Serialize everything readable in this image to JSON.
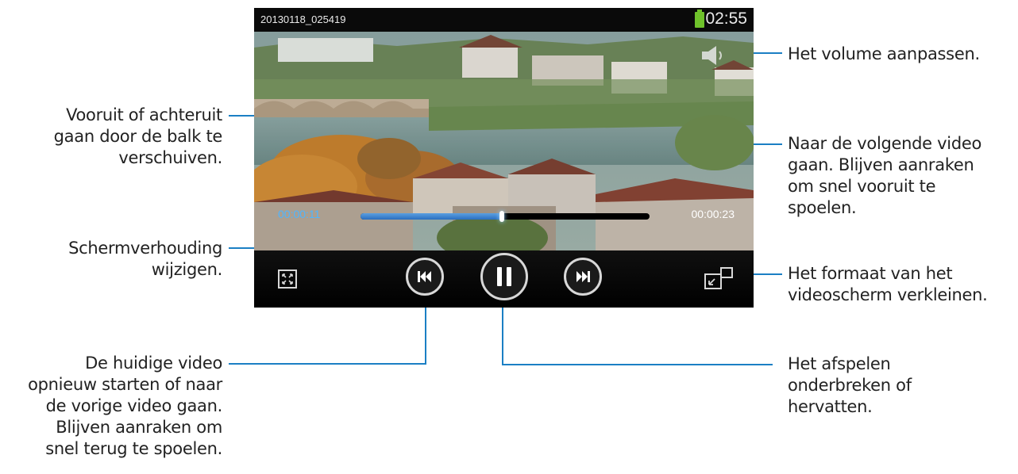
{
  "player": {
    "filename": "20130118_025419",
    "clock": "02:55",
    "elapsed": "00:00:11",
    "total": "00:00:23",
    "progress": 0.49,
    "accent_color": "#1b7fc4",
    "battery_color": "#6fc22b"
  },
  "icons": {
    "volume": "speaker-icon",
    "aspect": "aspect-ratio-icon",
    "prev": "skip-previous-icon",
    "pause": "pause-icon",
    "next": "skip-next-icon",
    "minimize": "picture-in-picture-icon"
  },
  "callouts": {
    "volume": "Het volume aanpassen.",
    "seek": "Vooruit of achteruit\ngaan door de balk te\nverschuiven.",
    "next": "Naar de volgende video\ngaan. Blijven aanraken\nom snel vooruit te\nspoelen.",
    "aspect": "Schermverhouding\nwijzigen.",
    "minimize": "Het formaat van het\nvideoscherm verkleinen.",
    "prev": "De huidige video\nopnieuw starten of naar\nde vorige video gaan.\nBlijven aanraken om\nsnel terug te spoelen.",
    "pause": "Het afspelen\nonderbreken of\nhervatten."
  }
}
